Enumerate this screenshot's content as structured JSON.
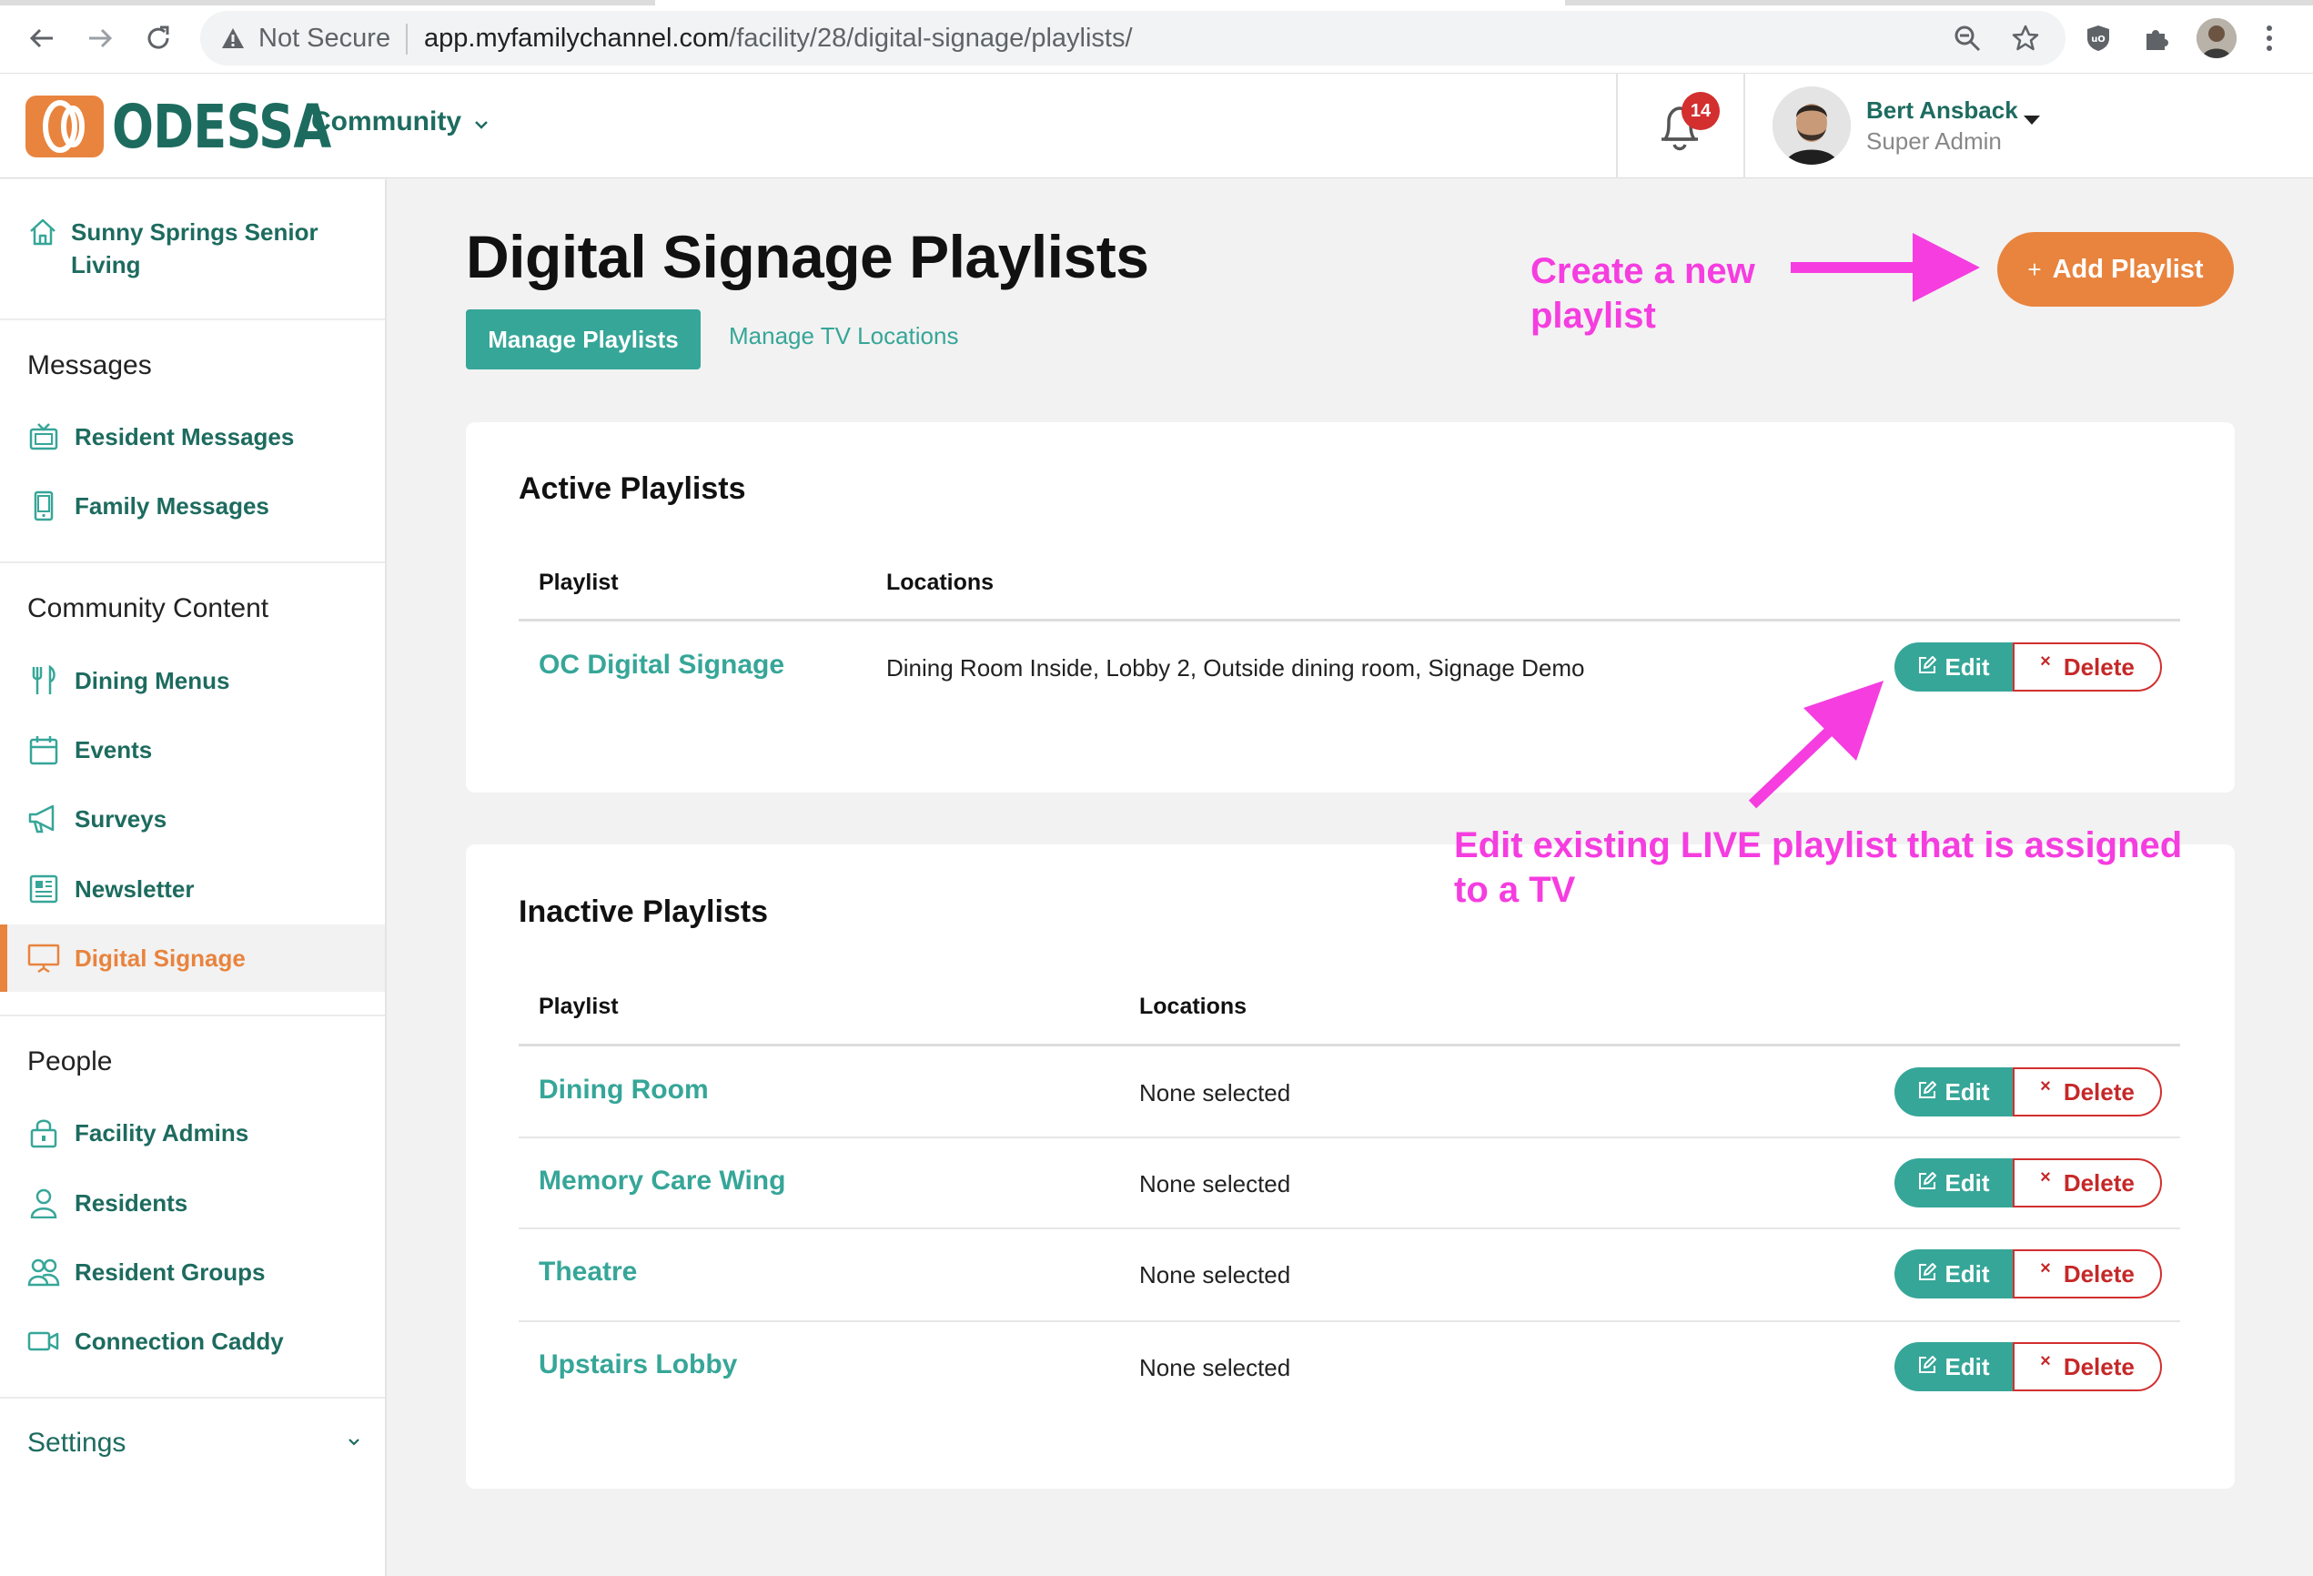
{
  "browser": {
    "security_label": "Not Secure",
    "url_host": "app.myfamilychannel.com",
    "url_path": "/facility/28/digital-signage/playlists/"
  },
  "header": {
    "logo_text": "ODESSA",
    "community_label": "Community",
    "notification_count": "14",
    "user_name": "Bert Ansback",
    "user_role": "Super Admin"
  },
  "sidebar": {
    "facility_name": "Sunny Springs Senior Living",
    "sections": {
      "messages": "Messages",
      "community_content": "Community Content",
      "people": "People",
      "settings": "Settings"
    },
    "items": {
      "resident_messages": "Resident Messages",
      "family_messages": "Family Messages",
      "dining_menus": "Dining Menus",
      "events": "Events",
      "surveys": "Surveys",
      "newsletter": "Newsletter",
      "digital_signage": "Digital Signage",
      "facility_admins": "Facility Admins",
      "residents": "Residents",
      "resident_groups": "Resident Groups",
      "connection_caddy": "Connection Caddy"
    }
  },
  "main": {
    "title": "Digital Signage Playlists",
    "tabs": {
      "manage_playlists": "Manage Playlists",
      "manage_tv_locations": "Manage TV Locations"
    },
    "add_playlist_label": "Add Playlist",
    "edit_label": "Edit",
    "delete_label": "Delete",
    "active": {
      "title": "Active Playlists",
      "col_playlist": "Playlist",
      "col_locations": "Locations",
      "rows": [
        {
          "name": "OC Digital Signage",
          "locations": "Dining Room Inside, Lobby 2, Outside dining room, Signage Demo"
        }
      ]
    },
    "inactive": {
      "title": "Inactive Playlists",
      "col_playlist": "Playlist",
      "col_locations": "Locations",
      "rows": [
        {
          "name": "Dining Room",
          "locations": "None selected"
        },
        {
          "name": "Memory Care Wing",
          "locations": "None selected"
        },
        {
          "name": "Theatre",
          "locations": "None selected"
        },
        {
          "name": "Upstairs Lobby",
          "locations": "None selected"
        }
      ]
    }
  },
  "annotations": {
    "create_line1": "Create a new",
    "create_line2": "playlist",
    "edit_line1": "Edit existing LIVE playlist that is assigned",
    "edit_line2": "to a TV"
  },
  "colors": {
    "teal": "#36a698",
    "dark_teal": "#1d6b5f",
    "orange": "#e8843e",
    "red": "#d32f2f",
    "annotation_magenta": "#f53de0"
  }
}
